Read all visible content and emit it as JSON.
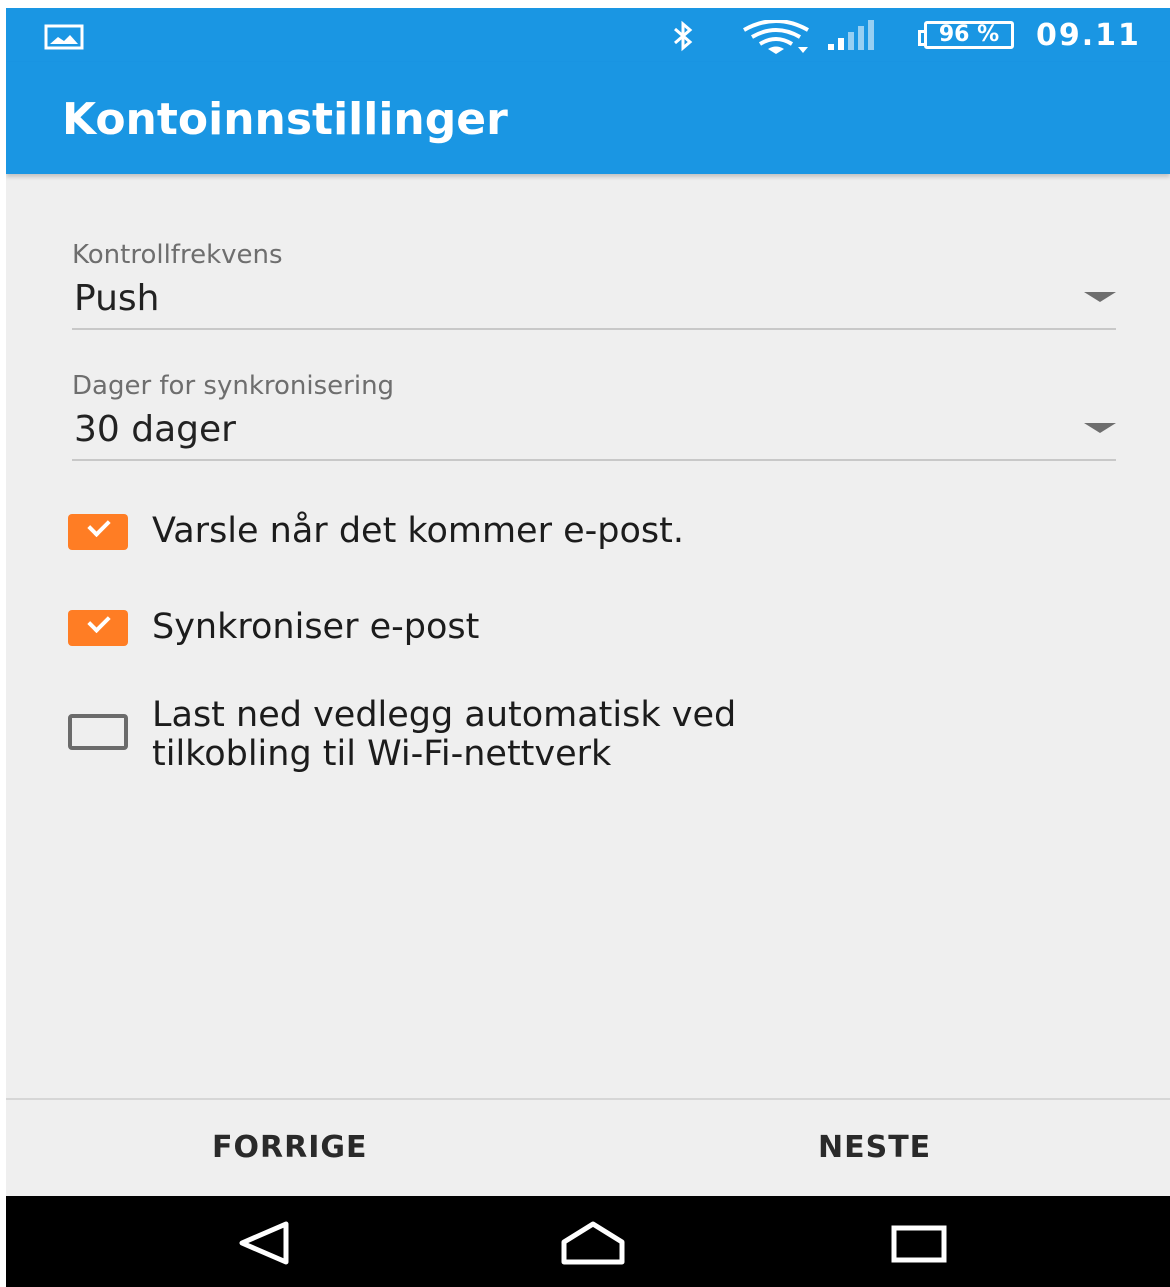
{
  "status_bar": {
    "battery": "96 %",
    "time": "09.11",
    "icons": [
      "gallery-icon",
      "bluetooth-icon",
      "wifi-icon",
      "signal-icon",
      "battery-icon"
    ]
  },
  "app_bar": {
    "title": "Kontoinnstillinger"
  },
  "form": {
    "check_frequency": {
      "label": "Kontrollfrekvens",
      "value": "Push"
    },
    "sync_days": {
      "label": "Dager for synkronisering",
      "value": "30 dager"
    },
    "checkboxes": [
      {
        "label": "Varsle når det kommer e-post.",
        "checked": true
      },
      {
        "label": "Synkroniser e-post",
        "checked": true
      },
      {
        "label_line1": "Last ned vedlegg automatisk ved",
        "label_line2": "tilkobling til Wi-Fi-nettverk",
        "checked": false
      }
    ]
  },
  "buttons": {
    "previous": "FORRIGE",
    "next": "NESTE"
  },
  "nav_bar": {
    "icons": [
      "back-icon",
      "home-icon",
      "recents-icon"
    ]
  },
  "colors": {
    "primary": "#1a96e3",
    "accent": "#ff7d24",
    "background": "#efefef"
  }
}
